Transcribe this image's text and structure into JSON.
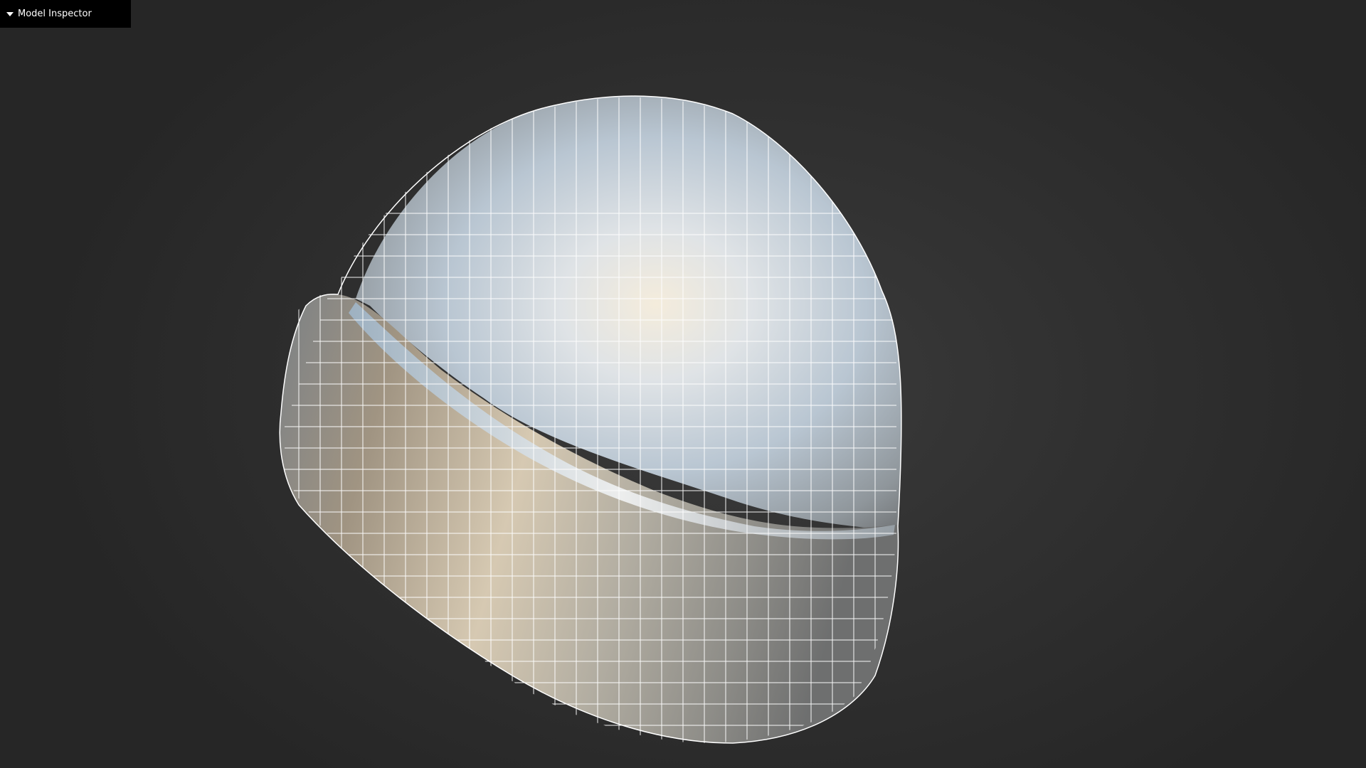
{
  "inspector": {
    "label": "Model Inspector",
    "toggle_icon": "triangle-down-icon"
  },
  "viewport": {
    "background_color": "#333333",
    "model": "beanie-hat",
    "display_mode": "wireframe-over-shaded",
    "wire_color": "#ffffff"
  }
}
